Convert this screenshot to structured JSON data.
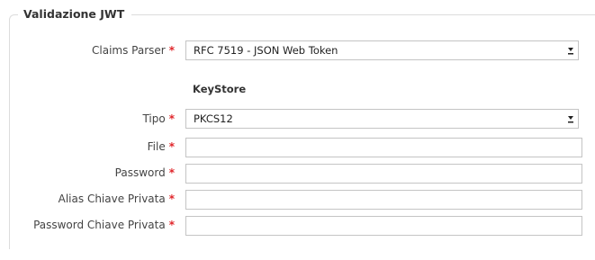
{
  "fieldset": {
    "legend": "Validazione JWT"
  },
  "claims_parser": {
    "label": "Claims Parser",
    "required": "*",
    "value": "RFC 7519 - JSON Web Token"
  },
  "keystore": {
    "title": "KeyStore"
  },
  "tipo": {
    "label": "Tipo",
    "required": "*",
    "value": "PKCS12"
  },
  "file": {
    "label": "File",
    "required": "*",
    "value": ""
  },
  "password": {
    "label": "Password",
    "required": "*",
    "value": ""
  },
  "alias_chiave_privata": {
    "label": "Alias Chiave Privata",
    "required": "*",
    "value": ""
  },
  "password_chiave_privata": {
    "label": "Password Chiave Privata",
    "required": "*",
    "value": ""
  },
  "icons": {
    "dropdown": "dropdown-arrow-icon"
  },
  "colors": {
    "required": "#e0262b",
    "border": "#c4c4c4",
    "fieldset_border": "#dcdcdc"
  }
}
